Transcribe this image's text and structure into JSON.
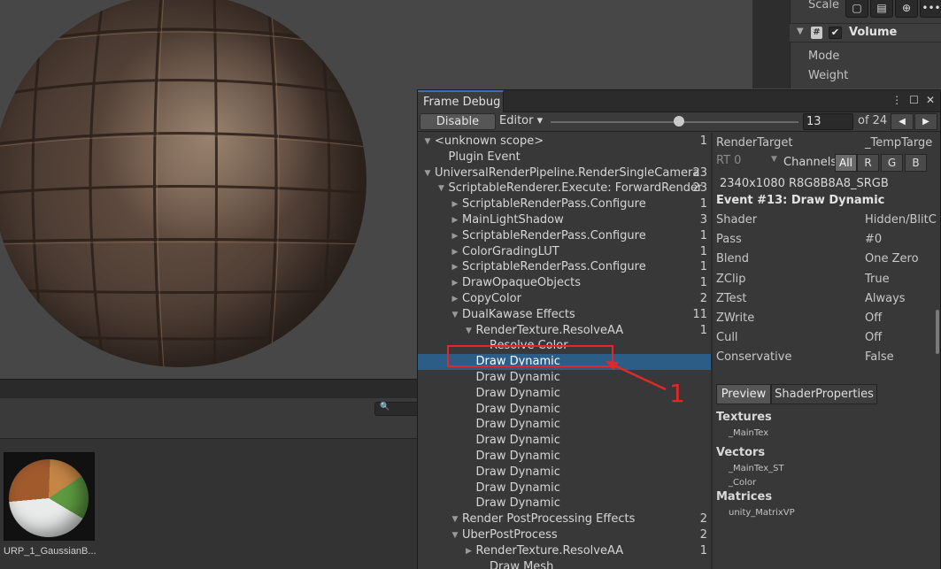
{
  "inspector": {
    "scale_label": "Scale",
    "buttons": [
      "comment-icon",
      "layout-icon",
      "download-icon",
      "more-icon"
    ],
    "component_icon": "#",
    "component_check": "✔",
    "component_name": "Volume",
    "fields": {
      "mode": "Mode",
      "weight": "Weight"
    }
  },
  "project": {
    "asset_name": "URP_1_GaussianB..."
  },
  "frame_debug": {
    "title": "Frame Debug",
    "toolbar": {
      "disable_label": "Disable",
      "editor_label": "Editor ▾",
      "event_value": "13",
      "of_label": "of 24",
      "prev_glyph": "◀",
      "next_glyph": "▶"
    },
    "tree": [
      {
        "depth": 0,
        "expanded": true,
        "label": "<unknown scope>",
        "count": "1"
      },
      {
        "depth": 1,
        "expanded": null,
        "label": "Plugin Event",
        "count": ""
      },
      {
        "depth": 0,
        "expanded": true,
        "label": "UniversalRenderPipeline.RenderSingleCamera",
        "count": "23"
      },
      {
        "depth": 1,
        "expanded": true,
        "label": "ScriptableRenderer.Execute: ForwardRender",
        "count": "23"
      },
      {
        "depth": 2,
        "expanded": false,
        "label": "ScriptableRenderPass.Configure",
        "count": "1"
      },
      {
        "depth": 2,
        "expanded": false,
        "label": "MainLightShadow",
        "count": "3"
      },
      {
        "depth": 2,
        "expanded": false,
        "label": "ScriptableRenderPass.Configure",
        "count": "1"
      },
      {
        "depth": 2,
        "expanded": false,
        "label": "ColorGradingLUT",
        "count": "1"
      },
      {
        "depth": 2,
        "expanded": false,
        "label": "ScriptableRenderPass.Configure",
        "count": "1"
      },
      {
        "depth": 2,
        "expanded": false,
        "label": "DrawOpaqueObjects",
        "count": "1"
      },
      {
        "depth": 2,
        "expanded": false,
        "label": "CopyColor",
        "count": "2"
      },
      {
        "depth": 2,
        "expanded": true,
        "label": " DualKawase Effects",
        "count": "11"
      },
      {
        "depth": 3,
        "expanded": true,
        "label": "RenderTexture.ResolveAA",
        "count": "1"
      },
      {
        "depth": 4,
        "expanded": null,
        "label": "Resolve Color",
        "count": ""
      },
      {
        "depth": 3,
        "expanded": null,
        "label": "Draw Dynamic",
        "count": "",
        "selected": true
      },
      {
        "depth": 3,
        "expanded": null,
        "label": "Draw Dynamic",
        "count": ""
      },
      {
        "depth": 3,
        "expanded": null,
        "label": "Draw Dynamic",
        "count": ""
      },
      {
        "depth": 3,
        "expanded": null,
        "label": "Draw Dynamic",
        "count": ""
      },
      {
        "depth": 3,
        "expanded": null,
        "label": "Draw Dynamic",
        "count": ""
      },
      {
        "depth": 3,
        "expanded": null,
        "label": "Draw Dynamic",
        "count": ""
      },
      {
        "depth": 3,
        "expanded": null,
        "label": "Draw Dynamic",
        "count": ""
      },
      {
        "depth": 3,
        "expanded": null,
        "label": "Draw Dynamic",
        "count": ""
      },
      {
        "depth": 3,
        "expanded": null,
        "label": "Draw Dynamic",
        "count": ""
      },
      {
        "depth": 3,
        "expanded": null,
        "label": "Draw Dynamic",
        "count": ""
      },
      {
        "depth": 2,
        "expanded": true,
        "label": "Render PostProcessing Effects",
        "count": "2"
      },
      {
        "depth": 2,
        "expanded": true,
        "label": "UberPostProcess",
        "count": "2",
        "indent_extra": true
      },
      {
        "depth": 3,
        "expanded": false,
        "label": "RenderTexture.ResolveAA",
        "count": "1",
        "indent_extra": true
      },
      {
        "depth": 4,
        "expanded": null,
        "label": "Draw Mesh",
        "count": ""
      }
    ],
    "details": {
      "render_target_label": "RenderTarget",
      "render_target_value": "_TempTarge",
      "rt_label": "RT 0",
      "channels_label": "Channels",
      "channels": [
        "All",
        "R",
        "G",
        "B"
      ],
      "format": "2340x1080 R8G8B8A8_SRGB",
      "event_title": "Event #13: Draw Dynamic",
      "props": [
        {
          "name": "Shader",
          "value": "Hidden/BlitC"
        },
        {
          "name": "Pass",
          "value": "#0"
        },
        {
          "name": "Blend",
          "value": "One Zero"
        },
        {
          "name": "ZClip",
          "value": "True"
        },
        {
          "name": "ZTest",
          "value": "Always"
        },
        {
          "name": "ZWrite",
          "value": "Off"
        },
        {
          "name": "Cull",
          "value": "Off"
        },
        {
          "name": "Conservative",
          "value": "False"
        }
      ],
      "tabs": {
        "preview": "Preview",
        "shader_properties": "ShaderProperties"
      },
      "sections": [
        {
          "title": "Textures",
          "items": [
            "_MainTex"
          ]
        },
        {
          "title": "Vectors",
          "items": [
            "_MainTex_ST",
            "_Color"
          ]
        },
        {
          "title": "Matrices",
          "items": [
            "unity_MatrixVP"
          ]
        }
      ]
    }
  },
  "annotation": {
    "number": "1",
    "color": "#e02828"
  },
  "colors": {
    "selection": "#2c5d87",
    "accent_tab": "#3a72b0"
  }
}
